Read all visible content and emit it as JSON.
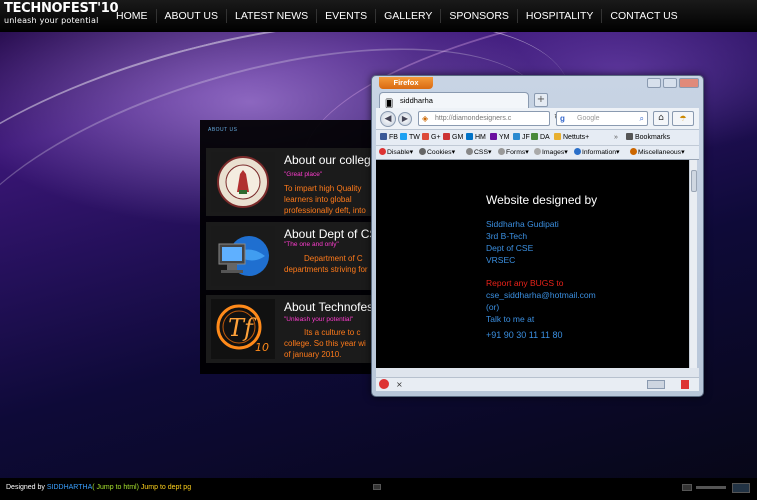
{
  "logo": {
    "title": "TECHNOFEST'10",
    "tagline": "unleash your potential"
  },
  "nav": [
    "HOME",
    "ABOUT US",
    "LATEST NEWS",
    "EVENTS",
    "GALLERY",
    "SPONSORS",
    "HOSPITALITY",
    "CONTACT US"
  ],
  "panel": {
    "heading": "ABOUT US",
    "cards": [
      {
        "title": "About our college",
        "quote": "\"Great place\"",
        "text": [
          "To impart high Quality",
          "learners into global",
          "professionally deft, into"
        ]
      },
      {
        "title": "About Dept of CSE",
        "quote": "\"The one and only\"",
        "text": [
          "Department of C",
          "departments striving for"
        ]
      },
      {
        "title": "About Technofest",
        "quote": "\"Unleash your potential\"",
        "text": [
          "Its a culture to c",
          "college. So this year wi",
          "of january 2010."
        ]
      }
    ]
  },
  "browser": {
    "menu_button": "Firefox",
    "tab_title": "siddharha",
    "new_tab": "+",
    "url": "http://diamondesigners.c",
    "search_placeholder": "Google",
    "bookmarks": [
      "FB",
      "TW",
      "G+",
      "GM",
      "HM",
      "YM",
      "JF",
      "DA",
      "Nettuts+",
      "Bookmarks"
    ],
    "devbar": [
      "Disable",
      "Cookies",
      "CSS",
      "Forms",
      "Images",
      "Information",
      "Miscellaneous"
    ],
    "content": {
      "heading": "Website designed by",
      "name": "Siddharha Gudipati",
      "year": "3rd B-Tech",
      "dept": "Dept of  CSE",
      "college": "VRSEC",
      "report_prefix": "Report any ",
      "report_bugs": "BUGS",
      "report_suffix": " to",
      "email": "cse_siddharha@hotmail.com",
      "or": "(or)",
      "talk": "Talk to me at",
      "phone": "+91 90 30 11 11 80"
    },
    "status_close": "×"
  },
  "footer": {
    "prefix": "Designed by ",
    "name": "SIDDHARTHA",
    "link1": "( Jump to html)",
    "link2": " Jump to dept pg"
  },
  "colors": {
    "accent_orange": "#ff7a1a",
    "quote_pink": "#ff3ccf",
    "link_blue": "#3b8fe0",
    "bugs_red": "#e8221a"
  }
}
